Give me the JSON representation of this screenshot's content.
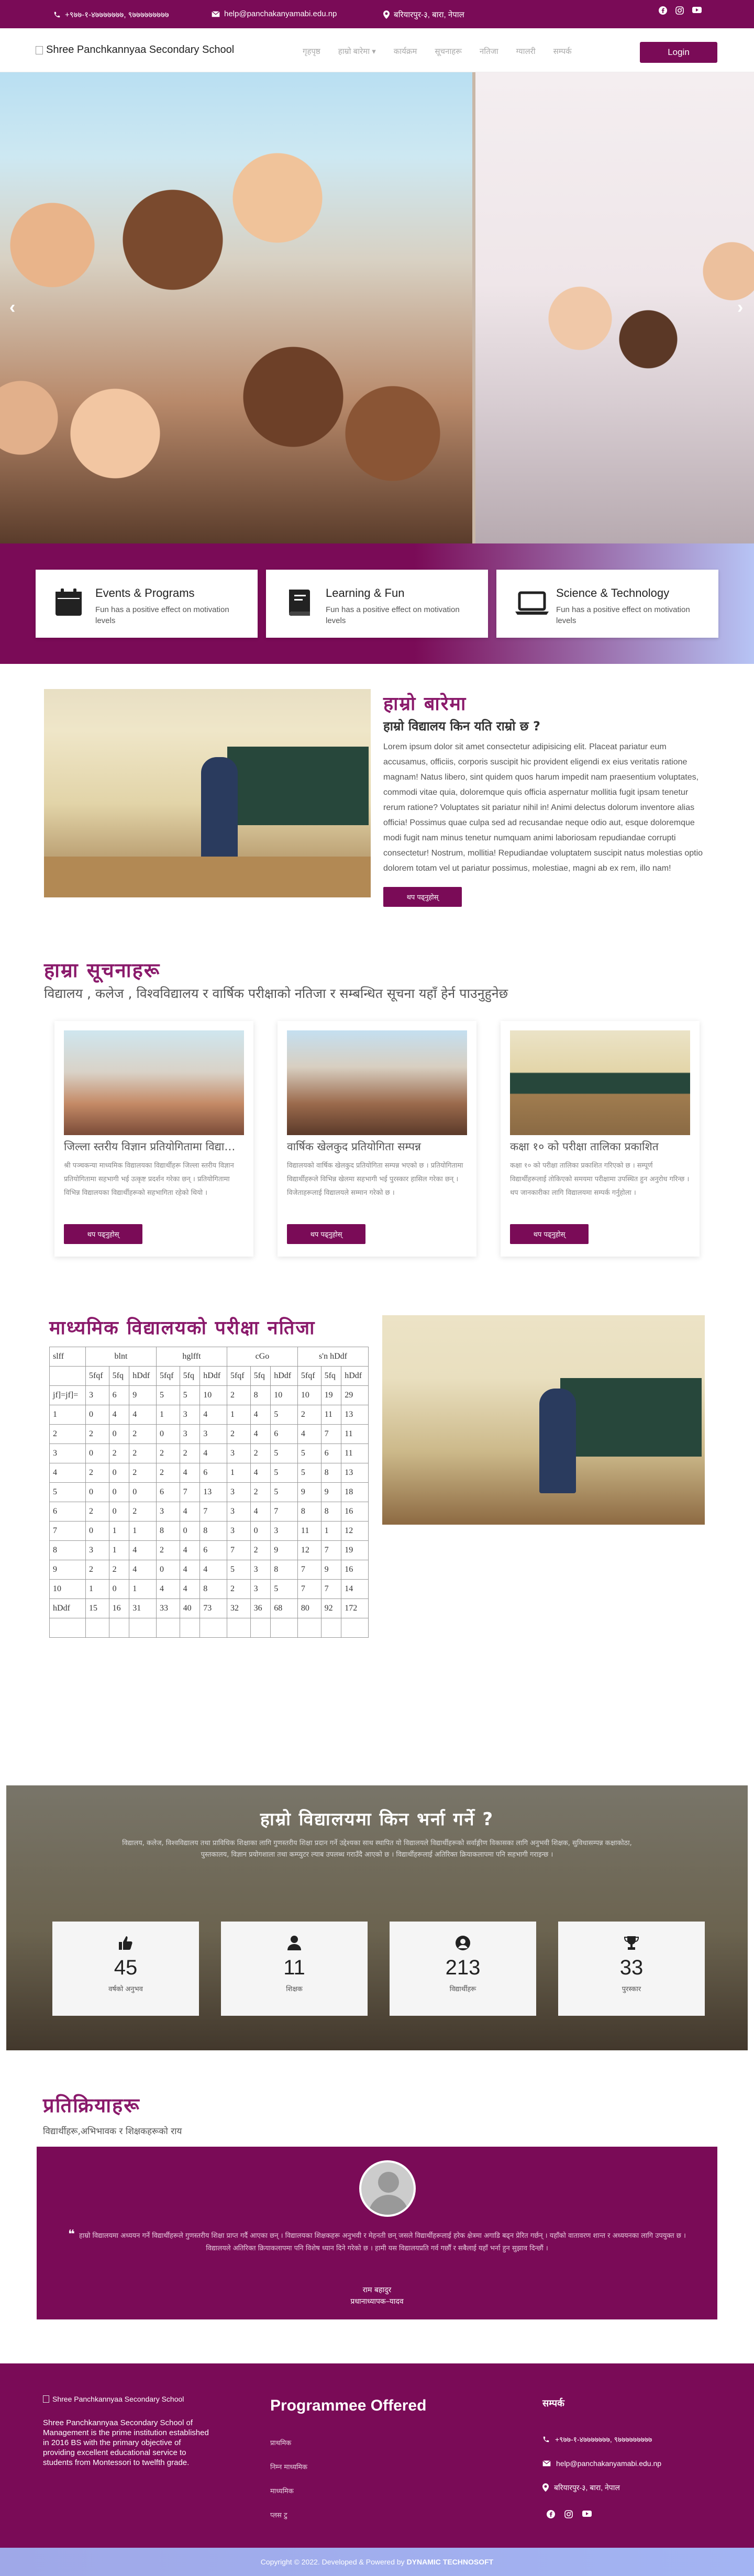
{
  "topbar": {
    "phone": "+९७७-१-४७७७७७७७, ९७७७७७७७७७",
    "email": "help@panchakanyamabi.edu.np",
    "address": "बरियारपुर-३, बारा, नेपाल",
    "social": [
      "facebook-icon",
      "instagram-icon",
      "youtube-icon"
    ]
  },
  "nav": {
    "logo_alt": "Shree Panchkannyaa Secondary School",
    "menu": [
      "गृहपृष्ठ",
      "हाम्रो बारेमा ▾",
      "कार्यक्रम",
      "सूचनाहरू",
      "नतिजा",
      "ग्यालरी",
      "सम्पर्क"
    ],
    "login": "Login"
  },
  "hero": {
    "prev": "‹",
    "next": "›"
  },
  "features": [
    {
      "icon": "calendar-icon",
      "title": "Events & Programs",
      "desc": "Fun has a positive effect on motivation levels"
    },
    {
      "icon": "book-icon",
      "title": "Learning & Fun",
      "desc": "Fun has a positive effect on motivation levels"
    },
    {
      "icon": "laptop-icon",
      "title": "Science & Technology",
      "desc": "Fun has a positive effect on motivation levels"
    }
  ],
  "about": {
    "heading": "हाम्रो बारेमा",
    "subheading": "हाम्रो विद्यालय किन यति राम्रो छ ?",
    "body": "Lorem ipsum dolor sit amet consectetur adipisicing elit. Placeat pariatur eum accusamus, officiis, corporis suscipit hic provident eligendi ex eius veritatis ratione magnam! Natus libero, sint quidem quos harum impedit nam praesentium voluptates, commodi vitae quia, doloremque quis officia aspernatur mollitia fugit ipsam tenetur rerum ratione? Voluptates sit pariatur nihil in! Animi delectus dolorum inventore alias officia! Possimus quae culpa sed ad recusandae neque odio aut, esque doloremque modi fugit nam minus tenetur numquam animi laboriosam repudiandae corrupti consectetur! Nostrum, mollitia! Repudiandae voluptatem suscipit natus molestias optio dolorem totam vel ut pariatur possimus, molestiae, magni ab ex rem, illo nam!",
    "button": "थप पढ्नुहोस्"
  },
  "notices": {
    "heading": "हाम्रा सूचनाहरू",
    "subheading": "विद्यालय , कलेज , विश्वविद्यालय र वार्षिक परीक्षाको नतिजा र सम्बन्धित सूचना यहाँ हेर्न पाउनुहुनेछ",
    "items": [
      {
        "title": "जिल्ला स्तरीय विज्ञान प्रतियोगितामा विद्यार्थी सहभागी",
        "desc": "श्री पञ्चकन्या माध्यमिक विद्यालयका विद्यार्थीहरू जिल्ला स्तरीय विज्ञान प्रतियोगितामा सहभागी भई उत्कृष्ट प्रदर्शन गरेका छन् । प्रतियोगितामा विभिन्न विद्यालयका विद्यार्थीहरूको सहभागिता रहेको थियो ।",
        "button": "थप पढ्नुहोस्"
      },
      {
        "title": "वार्षिक खेलकुद प्रतियोगिता सम्पन्न",
        "desc": "विद्यालयको वार्षिक खेलकुद प्रतियोगिता सम्पन्न भएको छ । प्रतियोगितामा विद्यार्थीहरूले विभिन्न खेलमा सहभागी भई पुरस्कार हासिल गरेका छन् । विजेताहरूलाई विद्यालयले सम्मान गरेको छ ।",
        "button": "थप पढ्नुहोस्"
      },
      {
        "title": "कक्षा १० को परीक्षा तालिका प्रकाशित",
        "desc": "कक्षा १० को परीक्षा तालिका प्रकाशित गरिएको छ । सम्पूर्ण विद्यार्थीहरूलाई तोकिएको समयमा परीक्षामा उपस्थित हुन अनुरोध गरिन्छ । थप जानकारीका लागि विद्यालयमा सम्पर्क गर्नुहोला ।",
        "button": "थप पढ्नुहोस्"
      }
    ]
  },
  "results": {
    "heading": "माध्यमिक विद्यालयको परीक्षा नतिजा",
    "header1": [
      "slff",
      "blnt",
      "hglfft",
      "cGo",
      "s'n hDdf"
    ],
    "header2": [
      "5fqf",
      "5fq",
      "hDdf",
      "5fqf",
      "5fq",
      "hDdf",
      "5fqf",
      "5fq",
      "hDdf",
      "5fqf",
      "5fq",
      "hDdf"
    ],
    "rows": [
      [
        "jf]=jf]=",
        "3",
        "6",
        "9",
        "5",
        "5",
        "10",
        "2",
        "8",
        "10",
        "10",
        "19",
        "29"
      ],
      [
        "1",
        "0",
        "4",
        "4",
        "1",
        "3",
        "4",
        "1",
        "4",
        "5",
        "2",
        "11",
        "13"
      ],
      [
        "2",
        "2",
        "0",
        "2",
        "0",
        "3",
        "3",
        "2",
        "4",
        "6",
        "4",
        "7",
        "11"
      ],
      [
        "3",
        "0",
        "2",
        "2",
        "2",
        "2",
        "4",
        "3",
        "2",
        "5",
        "5",
        "6",
        "11"
      ],
      [
        "4",
        "2",
        "0",
        "2",
        "2",
        "4",
        "6",
        "1",
        "4",
        "5",
        "5",
        "8",
        "13"
      ],
      [
        "5",
        "0",
        "0",
        "0",
        "6",
        "7",
        "13",
        "3",
        "2",
        "5",
        "9",
        "9",
        "18"
      ],
      [
        "6",
        "2",
        "0",
        "2",
        "3",
        "4",
        "7",
        "3",
        "4",
        "7",
        "8",
        "8",
        "16"
      ],
      [
        "7",
        "0",
        "1",
        "1",
        "8",
        "0",
        "8",
        "3",
        "0",
        "3",
        "11",
        "1",
        "12"
      ],
      [
        "8",
        "3",
        "1",
        "4",
        "2",
        "4",
        "6",
        "7",
        "2",
        "9",
        "12",
        "7",
        "19"
      ],
      [
        "9",
        "2",
        "2",
        "4",
        "0",
        "4",
        "4",
        "5",
        "3",
        "8",
        "7",
        "9",
        "16"
      ],
      [
        "10",
        "1",
        "0",
        "1",
        "4",
        "4",
        "8",
        "2",
        "3",
        "5",
        "7",
        "7",
        "14"
      ],
      [
        "hDdf",
        "15",
        "16",
        "31",
        "33",
        "40",
        "73",
        "32",
        "36",
        "68",
        "80",
        "92",
        "172"
      ],
      [
        "",
        "",
        "",
        "",
        "",
        "",
        "",
        "",
        "",
        "",
        "",
        "",
        ""
      ]
    ]
  },
  "why": {
    "heading": "हाम्रो विद्यालयमा किन भर्ना गर्ने ?",
    "body": "विद्यालय, कलेज, विश्वविद्यालय तथा प्राविधिक शिक्षाका लागि गुणस्तरीय शिक्षा प्रदान गर्ने उद्देश्यका साथ स्थापित यो विद्यालयले विद्यार्थीहरूको सर्वाङ्गीण विकासका लागि अनुभवी शिक्षक, सुविधासम्पन्न कक्षाकोठा, पुस्तकालय, विज्ञान प्रयोगशाला तथा कम्प्युटर ल्याब उपलब्ध गराउँदै आएको छ । विद्यार्थीहरूलाई अतिरिक्त क्रियाकलापमा पनि सहभागी गराइन्छ ।",
    "stats": [
      {
        "icon": "thumbs-up-icon",
        "value": "45",
        "label": "वर्षको अनुभव"
      },
      {
        "icon": "user-icon",
        "value": "11",
        "label": "शिक्षक"
      },
      {
        "icon": "user-circle-icon",
        "value": "213",
        "label": "विद्यार्थीहरू"
      },
      {
        "icon": "trophy-icon",
        "value": "33",
        "label": "पुरस्कार"
      }
    ]
  },
  "testimonials": {
    "heading": "प्रतिक्रियाहरू",
    "subheading": "विद्यार्थीहरू,अभिभावक र शिक्षकहरूको राय",
    "quote": "हाम्रो विद्यालयमा अध्ययन गर्ने विद्यार्थीहरूले गुणस्तरीय शिक्षा प्राप्त गर्दै आएका छन् । विद्यालयका शिक्षकहरू अनुभवी र मेहनती छन् जसले विद्यार्थीहरूलाई हरेक क्षेत्रमा अगाडि बढ्न प्रेरित गर्छन् । यहाँको वातावरण शान्त र अध्ययनका लागि उपयुक्त छ । विद्यालयले अतिरिक्त क्रियाकलापमा पनि विशेष ध्यान दिने गरेको छ । हामी यस विद्यालयप्रति गर्व गर्छौं र सबैलाई यहाँ भर्ना हुन सुझाव दिन्छौं ।",
    "name": "राम बहादुर",
    "role": "प्रधानाध्यापक–यादव"
  },
  "footer": {
    "logo_alt": "Shree Panchkannyaa Secondary School",
    "about": "Shree Panchkannyaa Secondary School of Management is the prime institution established in 2016 BS with the primary objective of providing excellent educational service to students from Montessori to twelfth grade.",
    "programmes_heading": "Programmee Offered",
    "programmes": [
      "प्राथमिक",
      "निम्न माध्यमिक",
      "माध्यमिक",
      "प्लस टु"
    ],
    "contact_heading": "सम्पर्क",
    "contact": {
      "phone": "+९७७-१-४७७७७७७७, ९७७७७७७७७७",
      "email": "help@panchakanyamabi.edu.np",
      "address": "बरियारपुर-३, बारा, नेपाल"
    },
    "social": [
      "facebook-icon",
      "instagram-icon",
      "youtube-icon"
    ]
  },
  "copyright": {
    "text": "Copyright © 2022. Developed & Powered by ",
    "company": "DYNAMIC TECHNOSOFT"
  },
  "colors": {
    "primary": "#7a0b57",
    "accent": "#8a1a6b",
    "footer_bottom": "#a3b4f3"
  }
}
